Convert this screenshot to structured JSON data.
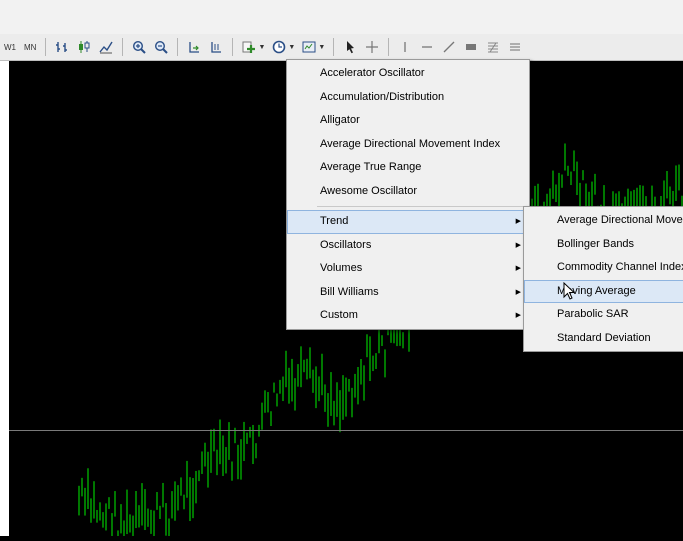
{
  "toolbar": {
    "timeframes": [
      "W1",
      "MN"
    ],
    "icons": [
      "bar-chart-icon",
      "candle-chart-icon",
      "line-chart-icon",
      "zoom-in-icon",
      "zoom-out-icon",
      "autoscroll-icon",
      "chart-shift-icon",
      "indicators-icon",
      "periods-icon",
      "templates-icon",
      "cursor-icon",
      "crosshair-icon",
      "vertical-line-icon",
      "horizontal-line-icon",
      "trendline-icon",
      "rectangle-icon",
      "fibonacci-icon",
      "channel-icon"
    ]
  },
  "indicators_menu": {
    "items": [
      "Accelerator Oscillator",
      "Accumulation/Distribution",
      "Alligator",
      "Average Directional Movement Index",
      "Average True Range",
      "Awesome Oscillator"
    ],
    "groups": [
      "Trend",
      "Oscillators",
      "Volumes",
      "Bill Williams",
      "Custom"
    ],
    "highlighted_group": "Trend"
  },
  "trend_submenu": {
    "items": [
      "Average Directional Move",
      "Bollinger Bands",
      "Commodity Channel Index",
      "Moving Average",
      "Parabolic SAR",
      "Standard Deviation"
    ],
    "highlighted": "Moving Average"
  },
  "colors": {
    "candle": "#00c800",
    "background": "#000000",
    "highlight": "#dce8f6"
  }
}
